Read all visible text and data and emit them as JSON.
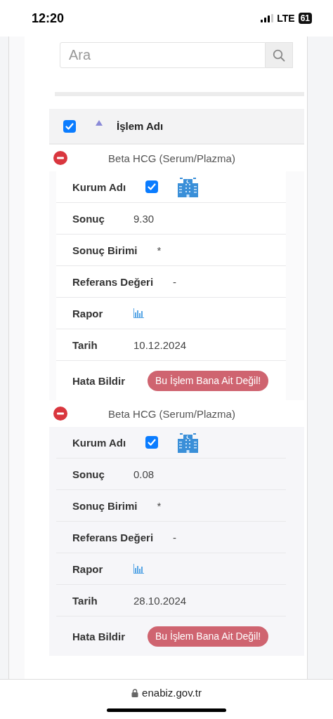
{
  "status_bar": {
    "time": "12:20",
    "network": "LTE",
    "battery": "61"
  },
  "search": {
    "placeholder": "Ara"
  },
  "table": {
    "header": {
      "checked": true,
      "sort_ascending": true,
      "column": "İşlem Adı"
    },
    "records": [
      {
        "title": "Beta HCG (Serum/Plazma)",
        "expanded": true,
        "fields": [
          {
            "kind": "check",
            "label": "Kurum Adı",
            "checked": true
          },
          {
            "kind": "text",
            "label": "Sonuç",
            "value": "9.30"
          },
          {
            "kind": "text",
            "label": "Sonuç Birimi",
            "value": "*"
          },
          {
            "kind": "text",
            "label": "Referans Değeri",
            "value": "-"
          },
          {
            "kind": "chart",
            "label": "Rapor"
          },
          {
            "kind": "text",
            "label": "Tarih",
            "value": "10.12.2024"
          },
          {
            "kind": "button",
            "label": "Hata Bildir",
            "button": "Bu İşlem Bana Ait Değil!"
          }
        ]
      },
      {
        "title": "Beta HCG (Serum/Plazma)",
        "expanded": true,
        "fields": [
          {
            "kind": "check",
            "label": "Kurum Adı",
            "checked": true
          },
          {
            "kind": "text",
            "label": "Sonuç",
            "value": "0.08"
          },
          {
            "kind": "text",
            "label": "Sonuç Birimi",
            "value": "*"
          },
          {
            "kind": "text",
            "label": "Referans Değeri",
            "value": "-"
          },
          {
            "kind": "chart",
            "label": "Rapor"
          },
          {
            "kind": "text",
            "label": "Tarih",
            "value": "28.10.2024"
          },
          {
            "kind": "button",
            "label": "Hata Bildir",
            "button": "Bu İşlem Bana Ait Değil!"
          }
        ]
      }
    ]
  },
  "browser": {
    "url": "enabiz.gov.tr"
  }
}
